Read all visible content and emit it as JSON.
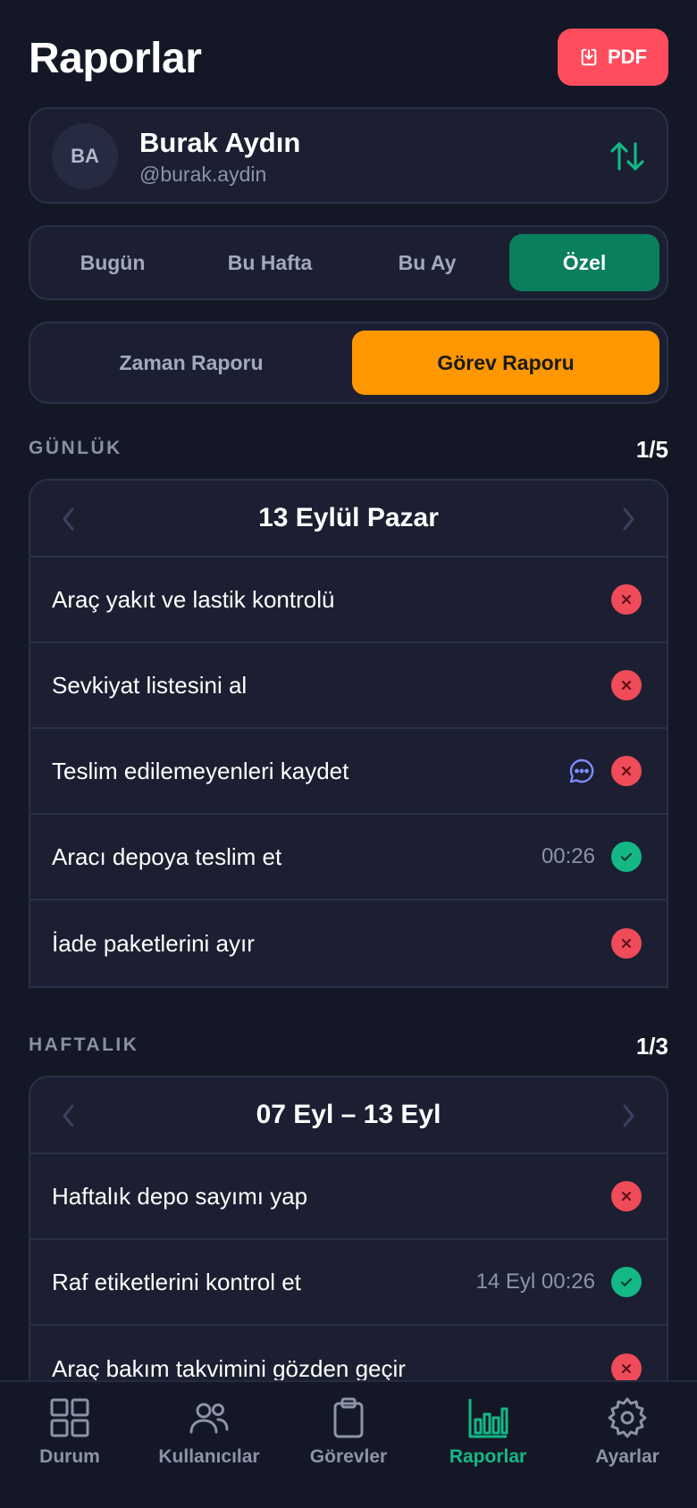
{
  "header": {
    "title": "Raporlar",
    "pdf_label": "PDF"
  },
  "user": {
    "initials": "BA",
    "name": "Burak Aydın",
    "handle": "@burak.aydin"
  },
  "period_tabs": [
    "Bugün",
    "Bu Hafta",
    "Bu Ay",
    "Özel"
  ],
  "period_active": "Özel",
  "report_tabs": [
    "Zaman Raporu",
    "Görev Raporu"
  ],
  "report_active": "Görev Raporu",
  "daily": {
    "label": "GÜNLÜK",
    "count": "1/5",
    "date": "13 Eylül Pazar",
    "tasks": [
      {
        "title": "Araç yakıt ve lastik kontrolü",
        "time": "",
        "status": "fail"
      },
      {
        "title": "Sevkiyat listesini al",
        "time": "",
        "status": "fail"
      },
      {
        "title": "Teslim edilemeyenleri kaydet",
        "time": "",
        "status": "fail",
        "note": true
      },
      {
        "title": "Aracı depoya teslim et",
        "time": "00:26",
        "status": "ok"
      },
      {
        "title": "İade paketlerini ayır",
        "time": "",
        "status": "fail"
      }
    ]
  },
  "weekly": {
    "label": "HAFTALIK",
    "count": "1/3",
    "date": "07 Eyl – 13 Eyl",
    "tasks": [
      {
        "title": "Haftalık depo sayımı yap",
        "time": "",
        "status": "fail"
      },
      {
        "title": "Raf etiketlerini kontrol et",
        "time": "14 Eyl 00:26",
        "status": "ok"
      },
      {
        "title": "Araç bakım takvimini gözden geçir",
        "time": "",
        "status": "fail"
      }
    ]
  },
  "bottom_nav": [
    {
      "label": "Durum",
      "icon": "grid-icon"
    },
    {
      "label": "Kullanıcılar",
      "icon": "users-icon"
    },
    {
      "label": "Görevler",
      "icon": "clipboard-icon"
    },
    {
      "label": "Raporlar",
      "icon": "bar-chart-icon"
    },
    {
      "label": "Ayarlar",
      "icon": "gear-icon"
    }
  ],
  "bottom_nav_active": "Raporlar",
  "colors": {
    "background": "#141826",
    "card": "#1b1f31",
    "accent_green": "#0a7f5e",
    "accent_orange": "#ff9800",
    "pdf_red": "#ff4d5e",
    "success": "#13b886",
    "fail": "#ef4b59"
  }
}
